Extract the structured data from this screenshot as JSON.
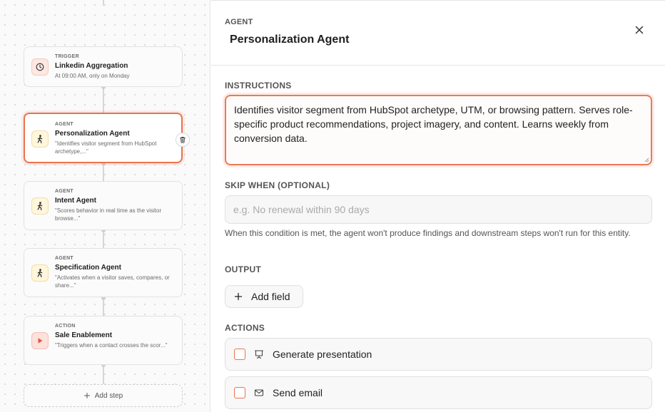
{
  "canvas": {
    "nodes": [
      {
        "kind": "TRIGGER",
        "title": "Linkedin Aggregation",
        "subtitle": "At 09:00 AM, only on Monday",
        "icon": "clock-icon"
      },
      {
        "kind": "AGENT",
        "title": "Personalization Agent",
        "subtitle": "\"Identifies visitor segment from HubSpot archetype,...\"",
        "icon": "agent-icon",
        "selected": true
      },
      {
        "kind": "AGENT",
        "title": "Intent Agent",
        "subtitle": "\"Scores behavior in real time as the visitor browse...\"",
        "icon": "agent-icon"
      },
      {
        "kind": "AGENT",
        "title": "Specification Agent",
        "subtitle": "\"Activates when a visitor saves, compares, or share...\"",
        "icon": "agent-icon"
      },
      {
        "kind": "ACTION",
        "title": "Sale Enablement",
        "subtitle": "\"Triggers when a contact crosses the scor...\"",
        "icon": "play-icon"
      }
    ],
    "add_step_label": "Add step"
  },
  "panel": {
    "kind": "AGENT",
    "title": "Personalization Agent",
    "instructions_label": "INSTRUCTIONS",
    "instructions_value": "Identifies visitor segment from HubSpot archetype, UTM, or browsing pattern. Serves role-specific product recommendations, project imagery, and content. Learns weekly from conversion data.",
    "skip_label": "SKIP WHEN (OPTIONAL)",
    "skip_placeholder": "e.g. No renewal within 90 days",
    "skip_help": "When this condition is met, the agent won't produce findings and downstream steps won't run for this entity.",
    "output_label": "OUTPUT",
    "add_field_label": "Add field",
    "actions_label": "ACTIONS",
    "actions": [
      {
        "label": "Generate presentation",
        "icon": "presentation-icon",
        "checked": false
      },
      {
        "label": "Send email",
        "icon": "mail-icon",
        "checked": false
      }
    ]
  },
  "colors": {
    "accent": "#e9734e",
    "border": "#e0e0e0"
  }
}
